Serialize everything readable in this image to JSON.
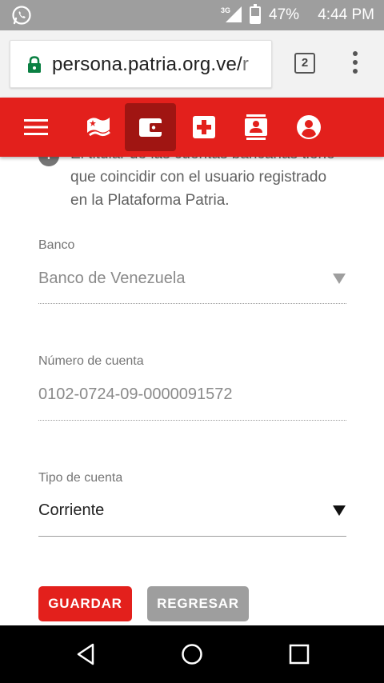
{
  "status_bar": {
    "network": "3G",
    "battery_percent": "47%",
    "battery_level": 0.47,
    "time": "4:44 PM"
  },
  "browser": {
    "url_main": "persona.patria.org.ve/",
    "url_rest": "r",
    "tab_count": "2",
    "icons": [
      "lock-icon",
      "tabs-icon",
      "more-vert-icon"
    ]
  },
  "app_nav": {
    "items": [
      {
        "name": "menu-icon",
        "active": false
      },
      {
        "name": "flag-icon",
        "active": false
      },
      {
        "name": "wallet-icon",
        "active": true
      },
      {
        "name": "medical-cross-icon",
        "active": false
      },
      {
        "name": "contact-card-icon",
        "active": false
      },
      {
        "name": "account-circle-icon",
        "active": false
      }
    ],
    "colors": {
      "bar": "#e3201c",
      "active": "#a01512"
    }
  },
  "form": {
    "info_text": "El titular de las cuentas bancarias tiene que coincidir con el usuario registrado en la Plataforma Patria.",
    "banco": {
      "label": "Banco",
      "value": "Banco de Venezuela"
    },
    "numero": {
      "label": "Número de cuenta",
      "value": "0102-0724-09-0000091572"
    },
    "tipo": {
      "label": "Tipo de cuenta",
      "value": "Corriente"
    },
    "buttons": {
      "save": "GUARDAR",
      "back": "REGRESAR"
    }
  }
}
